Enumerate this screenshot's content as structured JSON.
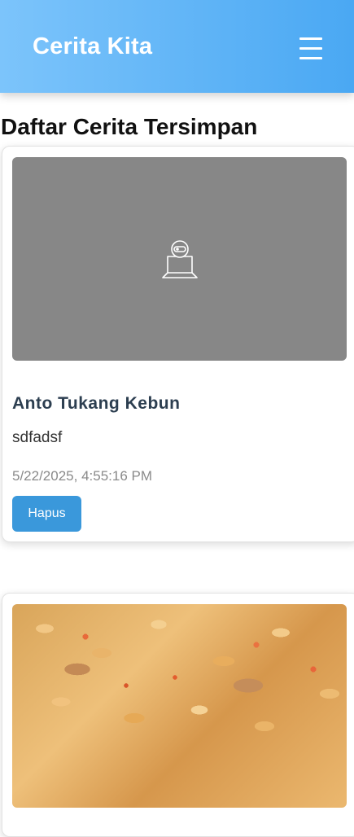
{
  "header": {
    "brand": "Cerita Kita",
    "menu_icon": "hamburger-menu-icon",
    "gradient_start": "#7cc4fb",
    "gradient_end": "#4aa8f3"
  },
  "page": {
    "title": "Daftar Cerita Tersimpan"
  },
  "stories": [
    {
      "image": "placeholder-camera-icon",
      "title": "Anto Tukang Kebun",
      "description": "sdfadsf",
      "date": "5/22/2025, 4:55:16 PM",
      "delete_label": "Hapus"
    },
    {
      "image": "food-photo"
    }
  ],
  "colors": {
    "button": "#3a98db",
    "story_title": "#2c3e50",
    "date_text": "#8a8a8a",
    "placeholder_bg": "#878787"
  }
}
